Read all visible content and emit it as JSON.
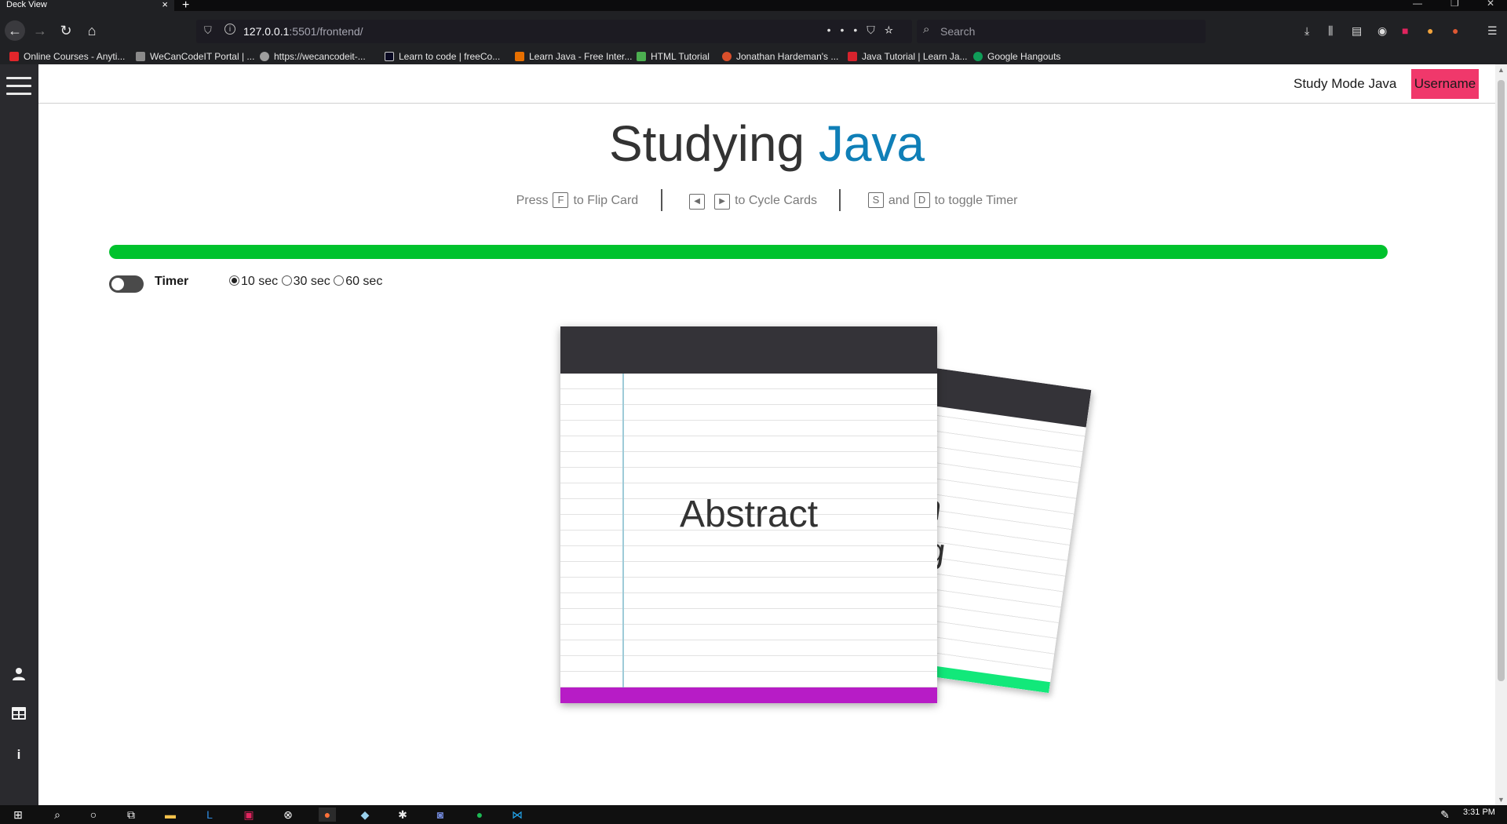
{
  "browser": {
    "tab_title": "Deck View",
    "url_host": "127.0.0.1",
    "url_rest": ":5501/frontend/",
    "search_placeholder": "Search"
  },
  "bookmarks": [
    {
      "label": "Online Courses - Anyti...",
      "color": "#e0262b"
    },
    {
      "label": "WeCanCodeIT Portal | ...",
      "color": "#8a8a8a"
    },
    {
      "label": "https://wecancodeit-...",
      "color": "#9e9e9e"
    },
    {
      "label": "Learn to code | freeCo...",
      "color": "#0a0a23"
    },
    {
      "label": "Learn Java - Free Inter...",
      "color": "#e76f00"
    },
    {
      "label": "HTML Tutorial",
      "color": "#4caf50"
    },
    {
      "label": "Jonathan Hardeman's ...",
      "color": "#d94f2b"
    },
    {
      "label": "Java Tutorial | Learn Ja...",
      "color": "#d6232d"
    },
    {
      "label": "Google Hangouts",
      "color": "#0f9d58"
    }
  ],
  "header": {
    "study_mode": "Study Mode Java",
    "username": "Username"
  },
  "heading": {
    "prefix": "Studying",
    "accent": "Java"
  },
  "hints": {
    "press": "Press",
    "key_f": "F",
    "flip": "to Flip Card",
    "key_left": "◀",
    "key_right": "▶",
    "cycle": "to Cycle Cards",
    "key_s": "S",
    "and": "and",
    "key_d": "D",
    "toggle": "to toggle Timer"
  },
  "progress": {
    "percent": 100,
    "color": "#00c22d"
  },
  "timer": {
    "label": "Timer",
    "enabled": false,
    "options": [
      "10 sec",
      "30 sec",
      "60 sec"
    ],
    "selected": "10 sec"
  },
  "cards": {
    "front_text": "Abstract",
    "back_line1": "n",
    "back_line2": "ng",
    "front_footer_color": "#b71cc6",
    "back_footer_color": "#12e87a"
  },
  "colors": {
    "accent": "#0f7fb7",
    "username_bg": "#f0386b"
  },
  "icons": {
    "sidebar": [
      "menu-icon",
      "user-icon",
      "table-icon",
      "info-icon"
    ]
  },
  "taskbar": {
    "time": "3:31 PM"
  }
}
